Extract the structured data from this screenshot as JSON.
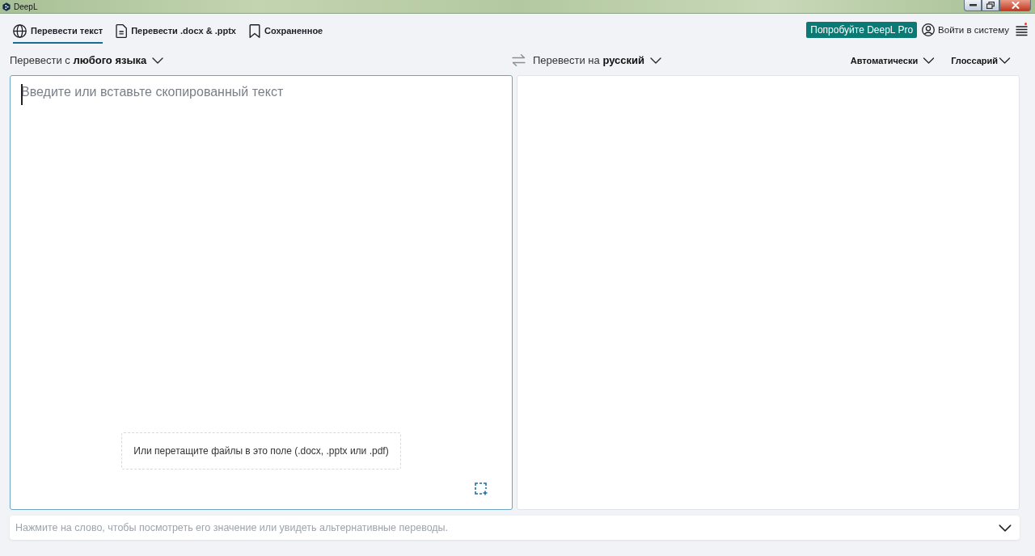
{
  "window": {
    "title": "DeepL"
  },
  "tabs": [
    {
      "label": "Перевести текст",
      "selected": true
    },
    {
      "label": "Перевести .docx & .pptx",
      "selected": false
    },
    {
      "label": "Сохраненное",
      "selected": false
    }
  ],
  "header": {
    "pro_button": "Попробуйте DeepL Pro",
    "login": "Войти в систему",
    "menu_notification": true
  },
  "source_language": {
    "label": "Перевести с **любого языка**"
  },
  "target_language": {
    "label": "Перевести на **русский**"
  },
  "options": [
    {
      "label": "Автоматически"
    },
    {
      "label": "Глоссарий"
    }
  ],
  "source": {
    "placeholder": "Введите или вставьте скопированный текст",
    "focused": true,
    "drop_hint": "Или перетащите файлы в это поле (.docx, .pptx или .pdf)"
  },
  "footer": {
    "hint": "Нажмите на слово, чтобы посмотреть его значение или увидеть альтернативные переводы."
  }
}
